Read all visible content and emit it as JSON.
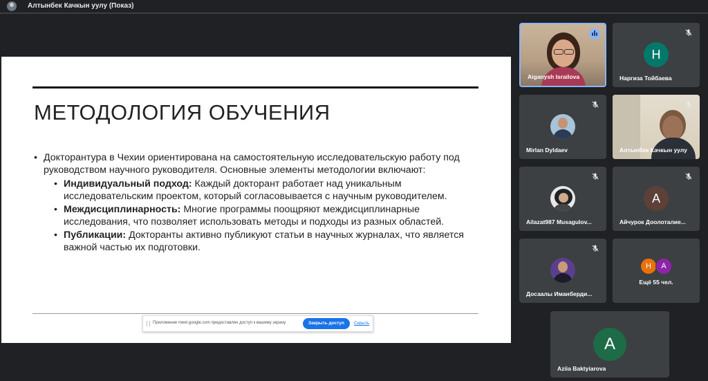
{
  "header": {
    "presenter_title": "Алтынбек Качкын уулу (Показ)"
  },
  "slide": {
    "title": "МЕТОДОЛОГИЯ ОБУЧЕНИЯ",
    "intro": "Докторантура в Чехии ориентирована на самостоятельную исследовательскую работу под руководством научного руководителя. Основные элементы методологии включают:",
    "items": [
      {
        "term": "Индивидуальный подход:",
        "text": " Каждый докторант работает над уникальным исследовательским проектом, который согласовывается с научным руководителем."
      },
      {
        "term": "Междисциплинарность:",
        "text": " Многие программы поощряют междисциплинарные исследования, что позволяет использовать методы и подходы из разных областей."
      },
      {
        "term": "Публикации:",
        "text": " Докторанты активно публикуют статьи в научных журналах, что является важной частью их подготовки."
      }
    ]
  },
  "share_bar": {
    "message": "Приложение meet.google.com предоставлен доступ к вашему экрану.",
    "stop_label": "Закрыть доступ",
    "hide_label": "Скрыть"
  },
  "participants": [
    {
      "name": "Aiganysh Israilova",
      "type": "video",
      "speaking": true
    },
    {
      "name": "Наргиза Тойбаева",
      "type": "letter",
      "letter": "Н",
      "color": "#00796b",
      "muted": true
    },
    {
      "name": "Mirlan Dyldaev",
      "type": "photo",
      "muted": true
    },
    {
      "name": "Алтынбек Качкын уулу",
      "type": "video",
      "muted": true
    },
    {
      "name": "Ailazat987 Musagulov...",
      "type": "photo",
      "muted": true
    },
    {
      "name": "Айчурок Доолоталие...",
      "type": "letter",
      "letter": "А",
      "color": "#5d4037",
      "muted": true
    },
    {
      "name": "Досаалы Иманберди...",
      "type": "photo",
      "muted": true
    },
    {
      "name": "Ещё 55 чел.",
      "type": "more",
      "letters": [
        "Н",
        "А"
      ],
      "colors": [
        "#e8710a",
        "#8e24aa"
      ]
    },
    {
      "name": "Aziia Baktyiarova",
      "type": "letter",
      "letter": "A",
      "color": "#1e6b47"
    }
  ]
}
